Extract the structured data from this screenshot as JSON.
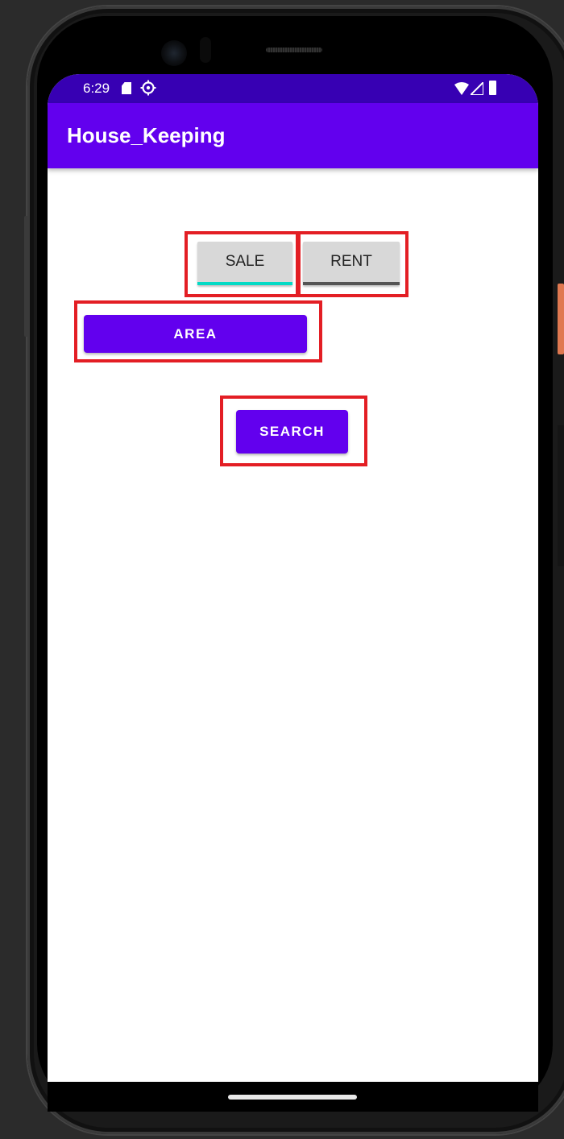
{
  "status_bar": {
    "time": "6:29",
    "icons": [
      "sd-card-icon",
      "settings-gear-icon",
      "wifi-icon",
      "signal-icon",
      "battery-icon"
    ]
  },
  "app_bar": {
    "title": "House_Keeping"
  },
  "toggles": {
    "sale_label": "SALE",
    "rent_label": "RENT",
    "sale_checked": true,
    "rent_checked": false
  },
  "buttons": {
    "area_label": "AREA",
    "search_label": "SEARCH"
  },
  "colors": {
    "primary": "#6200ee",
    "primary_dark": "#3700b3",
    "accent_on": "#03dac5",
    "indicator_off": "#555555",
    "highlight": "#e31e24"
  }
}
